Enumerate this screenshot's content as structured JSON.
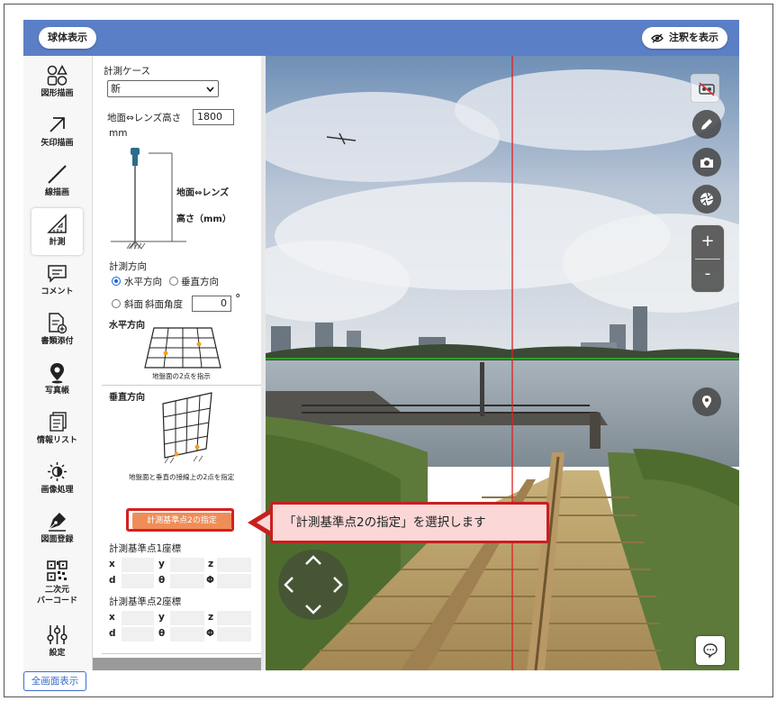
{
  "header": {
    "sphere_view_label": "球体表示",
    "show_annotation_label": "注釈を表示"
  },
  "sidebar": {
    "items": [
      {
        "label": "図形描画",
        "icon": "shapes-icon"
      },
      {
        "label": "矢印描画",
        "icon": "arrow-icon"
      },
      {
        "label": "線描画",
        "icon": "line-icon"
      },
      {
        "label": "計測",
        "icon": "measure-icon",
        "active": true
      },
      {
        "label": "コメント",
        "icon": "comment-icon"
      },
      {
        "label": "書類添付",
        "icon": "document-attach-icon"
      },
      {
        "label": "写真帳",
        "icon": "location-pin-icon"
      },
      {
        "label": "情報リスト",
        "icon": "info-list-icon"
      },
      {
        "label": "画像処理",
        "icon": "brightness-icon"
      },
      {
        "label": "図面登録",
        "icon": "pen-nib-icon"
      },
      {
        "label_line1": "二次元",
        "label_line2": "バーコード",
        "icon": "qr-code-icon"
      },
      {
        "label": "設定",
        "icon": "sliders-icon"
      }
    ]
  },
  "panel": {
    "case_label": "計測ケース",
    "case_value": "新",
    "lens_height_label": "地面⇔レンズ高さ",
    "lens_height_value": "1800",
    "lens_height_unit": "mm",
    "diagram_label_1": "地面⇔レンズ",
    "diagram_label_2": "高さ（mm）",
    "direction_label": "計測方向",
    "horizontal_option": "水平方向",
    "vertical_option": "垂直方向",
    "slope_option": "斜面",
    "slope_angle_label": "斜面角度",
    "slope_angle_value": "0",
    "degree_symbol": "°",
    "horizontal_heading": "水平方向",
    "horizontal_caption": "地盤面の2点を指示",
    "vertical_heading": "垂直方向",
    "vertical_caption": "地盤面と垂直の接線上の2点を指定",
    "designate_button": "計測基準点2の指定",
    "point1_label": "計測基準点1座標",
    "point2_label": "計測基準点2座標",
    "coord_labels": {
      "x": "x",
      "y": "y",
      "z": "z",
      "d": "d",
      "theta": "θ",
      "phi": "Φ"
    }
  },
  "callout_text": "「計測基準点2の指定」を選択します",
  "fullscreen_label": "全画面表示",
  "colors": {
    "header_blue": "#5b7fc6",
    "highlight_red": "#d62020",
    "button_orange": "#ef8d58",
    "callout_bg": "#fbd7d7"
  }
}
